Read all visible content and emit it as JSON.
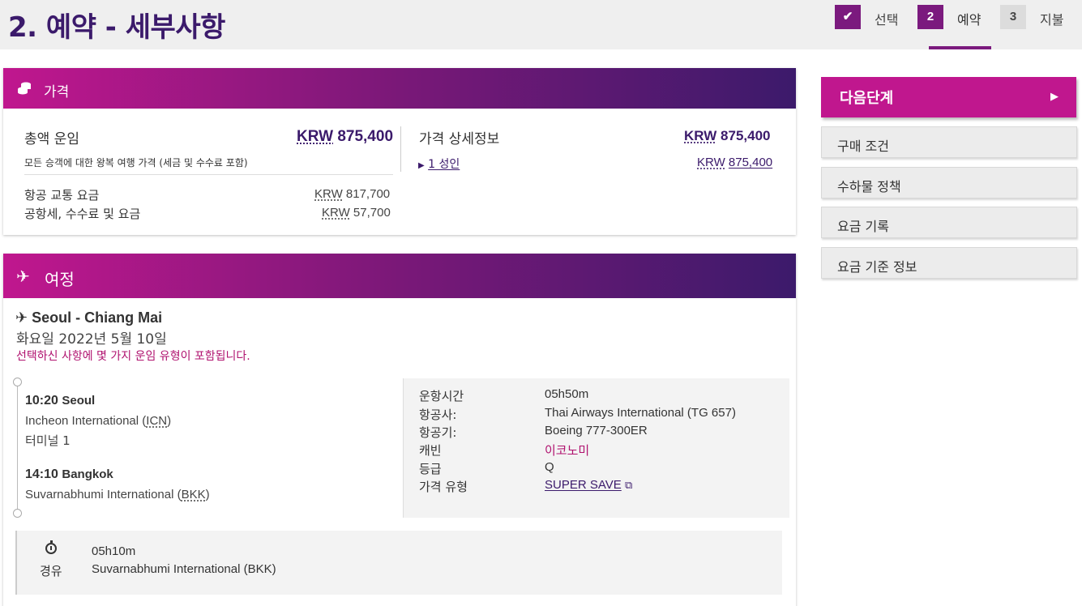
{
  "header": {
    "title": "2. 예약 - 세부사항",
    "steps": [
      {
        "number": "✔",
        "label": "선택",
        "state": "done"
      },
      {
        "number": "2",
        "label": "예약",
        "state": "current"
      },
      {
        "number": "3",
        "label": "지불",
        "state": "upcoming"
      }
    ]
  },
  "price": {
    "section_title": "가격",
    "total_label": "총액 운임",
    "total_currency": "KRW",
    "total_amount": "875,400",
    "total_note": "모든 승객에 대한 왕복 여행 가격 (세금 및 수수료 포함)",
    "rows": [
      {
        "label": "항공 교통 요금",
        "currency": "KRW",
        "amount": "817,700"
      },
      {
        "label": "공항세, 수수료 및 요금",
        "currency": "KRW",
        "amount": "57,700"
      }
    ],
    "detail_title": "가격 상세정보",
    "detail_currency": "KRW",
    "detail_amount": "875,400",
    "passenger_link": "1 성인",
    "passenger_currency": "KRW",
    "passenger_amount": "875,400"
  },
  "itinerary": {
    "section_title": "여정",
    "route": "Seoul - Chiang Mai",
    "date": "화요일 2022년 5월 10일",
    "warning": "선택하신 사항에 몇 가지 운임 유형이 포함됩니다.",
    "departure": {
      "time": "10:20",
      "city": "Seoul",
      "airport": "Incheon International (",
      "code": "ICN",
      "airport_end": ")",
      "terminal": "터미널 1"
    },
    "arrival": {
      "time": "14:10",
      "city": "Bangkok",
      "airport": "Suvarnabhumi International (",
      "code": "BKK",
      "airport_end": ")"
    },
    "details": [
      {
        "label": "운항시간",
        "value": "05h50m"
      },
      {
        "label": "항공사:",
        "value": "Thai Airways International (TG 657)"
      },
      {
        "label": "항공기:",
        "value": "Boeing 777-300ER"
      },
      {
        "label": "캐빈",
        "value": "이코노미"
      },
      {
        "label": "등급",
        "value": "Q"
      },
      {
        "label": "가격 유형",
        "value": "SUPER SAVE"
      }
    ],
    "stopover": {
      "duration": "05h10m",
      "label": "경유",
      "airport": "Suvarnabhumi International (BKK)"
    }
  },
  "sidebar": {
    "next_label": "다음단계",
    "buttons": [
      "구매 조건",
      "수하물 정책",
      "요금 기록",
      "요금 기준 정보"
    ]
  },
  "colors": {
    "brand_magenta": "#c0178e",
    "brand_purple": "#3b1a6b"
  }
}
